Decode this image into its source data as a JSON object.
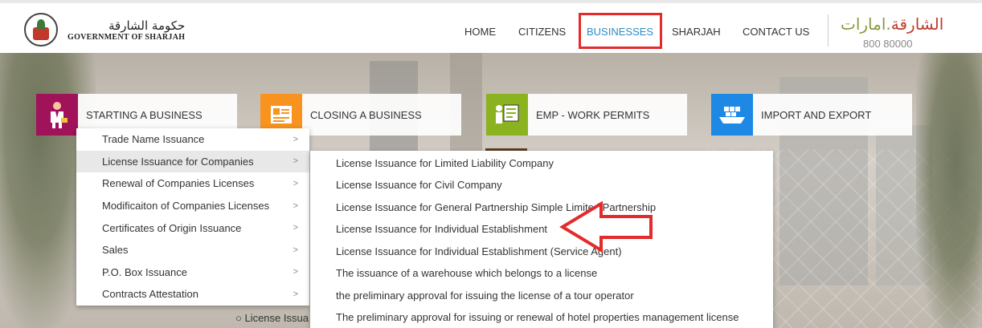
{
  "header": {
    "logo_ar": "حكومة الشارقة",
    "logo_en": "GOVERNMENT OF SHARJAH",
    "brand_ar_part1": "الشارقة",
    "brand_ar_part2": ".امارات",
    "phone": "800 80000"
  },
  "nav": {
    "items": [
      {
        "label": "HOME"
      },
      {
        "label": "CITIZENS"
      },
      {
        "label": "BUSINESSES",
        "active": true
      },
      {
        "label": "SHARJAH"
      },
      {
        "label": "CONTACT US"
      }
    ]
  },
  "tiles": [
    {
      "label": "STARTING A BUSINESS",
      "color": "#a0125a",
      "icon": "businessman-icon"
    },
    {
      "label": "CLOSING A BUSINESS",
      "color": "#f7931e",
      "icon": "certificate-icon"
    },
    {
      "label": "EMP - WORK PERMITS",
      "color": "#8ab31f",
      "icon": "presentation-icon"
    },
    {
      "label": "IMPORT AND EXPORT",
      "color": "#1e88e5",
      "icon": "cargo-ship-icon"
    }
  ],
  "submenu": {
    "items": [
      {
        "label": "Trade Name Issuance"
      },
      {
        "label": "License Issuance for Companies",
        "highlighted": true
      },
      {
        "label": "Renewal of Companies Licenses"
      },
      {
        "label": "Modificaiton of Companies Licenses"
      },
      {
        "label": "Certificates of Origin Issuance"
      },
      {
        "label": "Sales"
      },
      {
        "label": "P.O. Box Issuance"
      },
      {
        "label": "Contracts Attestation"
      }
    ],
    "chevron": ">"
  },
  "flyout": {
    "items": [
      {
        "label": "License Issuance for Limited Liability Company"
      },
      {
        "label": "License Issuance for Civil Company"
      },
      {
        "label": "License Issuance for General Partnership Simple Limited Partnership"
      },
      {
        "label": "License Issuance for Individual Establishment"
      },
      {
        "label": "License Issuance for Individual Establishment (Service Agent)"
      },
      {
        "label": "The issuance of a warehouse which belongs to a license"
      },
      {
        "label": "the preliminary approval for issuing the license of a tour operator"
      },
      {
        "label": "The preliminary approval for issuing or renewal of hotel properties management license"
      }
    ]
  },
  "behind_text": "○ License Issua",
  "colors": {
    "annotation_red": "#e32b2b",
    "nav_active": "#2e8bc9"
  }
}
